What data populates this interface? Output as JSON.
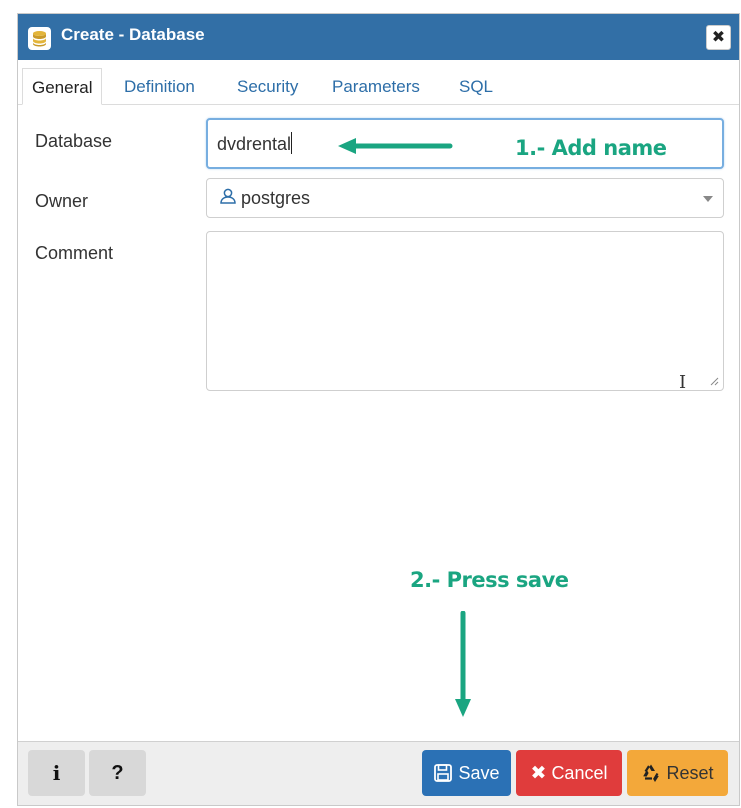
{
  "window": {
    "title": "Create - Database",
    "close_icon": "close-icon",
    "title_icon": "database-icon"
  },
  "tabs": [
    {
      "label": "General",
      "active": true
    },
    {
      "label": "Definition",
      "active": false
    },
    {
      "label": "Security",
      "active": false
    },
    {
      "label": "Parameters",
      "active": false
    },
    {
      "label": "SQL",
      "active": false
    }
  ],
  "form": {
    "database_label": "Database",
    "database_value": "dvdrental",
    "owner_label": "Owner",
    "owner_value": "postgres",
    "owner_icon": "user-icon",
    "comment_label": "Comment",
    "comment_value": ""
  },
  "annotations": {
    "add_name": "1.- Add name",
    "press_save": "2.- Press save",
    "color": "#1aa581"
  },
  "footer": {
    "info_label": "i",
    "help_label": "?",
    "save_label": "Save",
    "cancel_label": "Cancel",
    "reset_label": "Reset"
  },
  "colors": {
    "titlebar": "#326fa6",
    "save": "#2b71b5",
    "cancel": "#e03c3c",
    "reset": "#f3a83a"
  }
}
